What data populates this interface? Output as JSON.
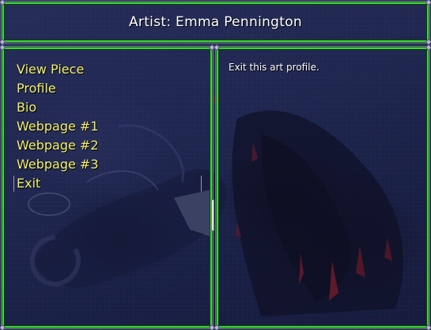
{
  "window": {
    "title": "Artist: Emma Pennington"
  },
  "menu": {
    "items": [
      {
        "label": "View Piece"
      },
      {
        "label": "Profile"
      },
      {
        "label": "Bio"
      },
      {
        "label": "Webpage #1"
      },
      {
        "label": "Webpage #2"
      },
      {
        "label": "Webpage #3"
      },
      {
        "label": "Exit"
      }
    ],
    "selected_index": 6
  },
  "help": {
    "text": "Exit this art profile."
  },
  "colors": {
    "frame_border": "#3fd23f",
    "menu_text": "#f3f06a",
    "title_text": "#ffffff",
    "background": "#232b55"
  }
}
